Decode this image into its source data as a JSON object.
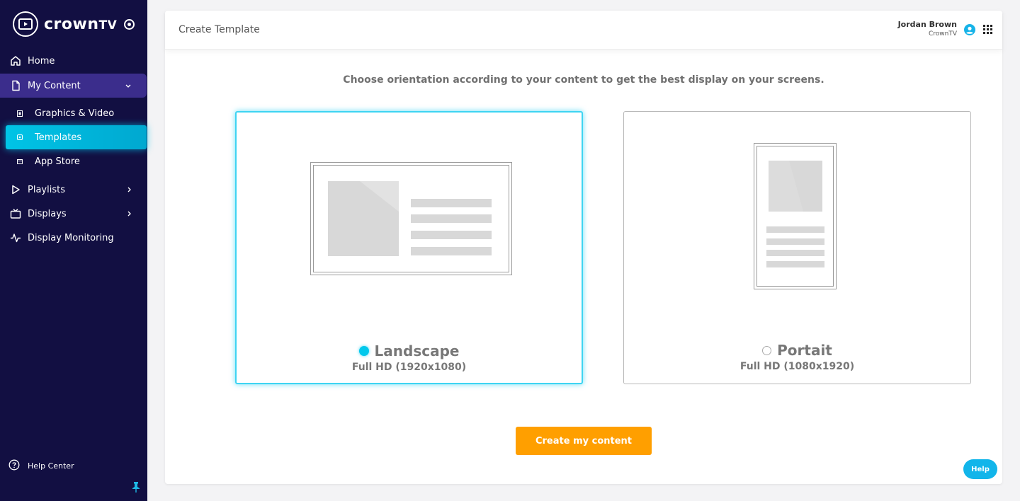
{
  "brand": {
    "name": "crown",
    "suffix": "TV"
  },
  "sidebar": {
    "items": [
      {
        "label": "Home",
        "icon": "home-icon"
      },
      {
        "label": "My Content",
        "icon": "file-icon",
        "expanded": true
      },
      {
        "label": "Playlists",
        "icon": "play-icon"
      },
      {
        "label": "Displays",
        "icon": "tv-icon"
      },
      {
        "label": "Display Monitoring",
        "icon": "activity-icon"
      }
    ],
    "sub_items": [
      {
        "label": "Graphics & Video",
        "icon": "film-icon"
      },
      {
        "label": "Templates",
        "icon": "template-icon",
        "active": true
      },
      {
        "label": "App Store",
        "icon": "store-icon"
      }
    ],
    "help_center": "Help Center"
  },
  "header": {
    "title": "Create Template",
    "user_name": "Jordan Brown",
    "user_org": "CrownTV"
  },
  "main": {
    "instruction": "Choose orientation according to your content to get the best display on your screens.",
    "options": [
      {
        "title": "Landscape",
        "subtitle": "Full HD (1920x1080)",
        "selected": true
      },
      {
        "title": "Portait",
        "subtitle": "Full HD (1080x1920)",
        "selected": false
      }
    ],
    "cta_label": "Create my content",
    "help_label": "Help"
  },
  "colors": {
    "sidebar_bg": "#120f42",
    "active_sub": "#00c4e6",
    "accent_orange": "#ff9f00",
    "selected_border": "#3ed4f2"
  }
}
